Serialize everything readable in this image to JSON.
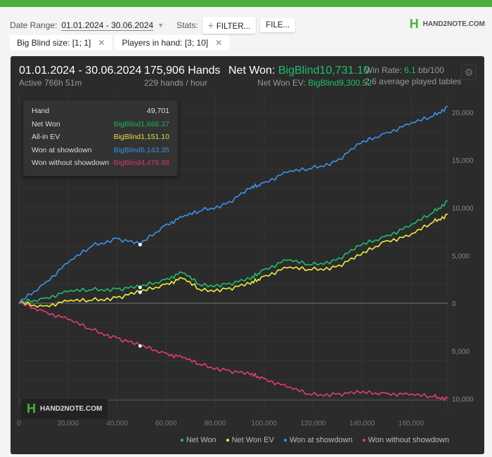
{
  "filters": {
    "date_label": "Date Range:",
    "date_value": "01.01.2024 - 30.06.2024",
    "stats_label": "Stats:",
    "filter_button": "FILTER...",
    "file_button": "FILE...",
    "logo": "HAND2NOTE.COM"
  },
  "chips": [
    {
      "label": "Big Blind size: [1; 1]"
    },
    {
      "label": "Players in hand: [3; 10]"
    }
  ],
  "summary": {
    "range": "01.01.2024 - 30.06.2024",
    "active": "Active 766h 51m",
    "hands": "175,906 Hands",
    "hands_per_hour": "229 hands / hour",
    "net_won_label": "Net Won: ",
    "net_won_value": "BigBlind10,731.10",
    "ev_label": "Net Won  EV: ",
    "ev_value": "BigBlind9,300.52",
    "winrate_label": "Win Rate: ",
    "winrate_value": "6.1",
    "winrate_unit": " bb/100",
    "tables": "2.6 average played tables"
  },
  "tooltip": [
    {
      "label": "Hand",
      "value": "49,701",
      "color": "#dddddd"
    },
    {
      "label": "Net Won",
      "value": "BigBlind1,666.37",
      "color": "#1fae5e"
    },
    {
      "label": "All-in EV",
      "value": "BigBlind1,151.10",
      "color": "#e0e040"
    },
    {
      "label": "Won at showdown",
      "value": "BigBlind6,143.35",
      "color": "#3a8ee0"
    },
    {
      "label": "Won without showdown",
      "value": "-BigBlind4,476.98",
      "color": "#d8366a"
    }
  ],
  "watermark": "HAND2NOTE.COM",
  "colors": {
    "net_won": "#1fbf6a",
    "ev": "#f0f040",
    "showdown": "#3a94ec",
    "no_showdown": "#e83a78"
  },
  "chart_data": {
    "type": "line",
    "xlim": [
      0,
      175906
    ],
    "ylim": [
      -11000,
      22000
    ],
    "x_ticks": [
      "0",
      "20,000",
      "40,000",
      "60,000",
      "80,000",
      "100,000",
      "120,000",
      "140,000",
      "160,000"
    ],
    "y_ticks": [
      {
        "v": 20000,
        "label": "20,000"
      },
      {
        "v": 15000,
        "label": "15,000"
      },
      {
        "v": 10000,
        "label": "10,000"
      },
      {
        "v": 5000,
        "label": "5,000"
      },
      {
        "v": 0,
        "label": "0"
      },
      {
        "v": -5000,
        "label": "5,000"
      },
      {
        "v": -10000,
        "label": "10,000"
      }
    ],
    "x": [
      0,
      10000,
      20000,
      30000,
      40000,
      49701,
      60000,
      67000,
      75000,
      85000,
      95000,
      100000,
      110000,
      120000,
      130000,
      140000,
      150000,
      160000,
      170000,
      175906
    ],
    "series": [
      {
        "name": "Net Won",
        "color": "#1fbf6a",
        "values": [
          0,
          500,
          1200,
          1400,
          1500,
          1666,
          2500,
          3200,
          1800,
          2000,
          2500,
          3500,
          4500,
          4000,
          4500,
          6000,
          7000,
          8000,
          9500,
          10731
        ]
      },
      {
        "name": "Net Won  EV",
        "color": "#f0f040",
        "values": [
          0,
          -300,
          200,
          300,
          600,
          1151,
          2000,
          2600,
          1300,
          1500,
          2000,
          2800,
          3700,
          3500,
          3800,
          5000,
          6500,
          7000,
          8500,
          9300
        ]
      },
      {
        "name": "Won at showdown",
        "color": "#3a94ec",
        "values": [
          0,
          2000,
          4200,
          6000,
          6800,
          6143,
          8200,
          9000,
          9700,
          10400,
          12000,
          12600,
          13700,
          14100,
          14850,
          16700,
          17800,
          18700,
          19600,
          20600
        ]
      },
      {
        "name": "Won without showdown",
        "color": "#e83a78",
        "values": [
          0,
          -800,
          -1700,
          -2800,
          -3600,
          -4477,
          -5200,
          -5700,
          -6500,
          -7000,
          -7500,
          -7800,
          -8800,
          -9600,
          -9500,
          -9400,
          -9400,
          -9600,
          -9800,
          -9950
        ]
      }
    ],
    "legend": "bottom-right",
    "grid": true
  }
}
